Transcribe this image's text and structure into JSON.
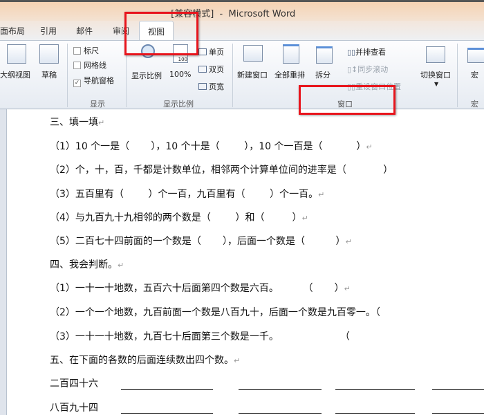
{
  "window": {
    "title": "一 [兼容模式]  -  Microsoft Word"
  },
  "tabs": [
    {
      "label": "面布局"
    },
    {
      "label": "引用"
    },
    {
      "label": "邮件"
    },
    {
      "label": "审阅"
    },
    {
      "label": "视图",
      "active": true
    }
  ],
  "ribbon": {
    "views": {
      "outline": "大纲视图",
      "draft": "草稿"
    },
    "show": {
      "label": "显示",
      "ruler": "标尺",
      "gridlines": "网格线",
      "nav_pane": "导航窗格",
      "ruler_checked": false,
      "gridlines_checked": false,
      "nav_pane_checked": true,
      "check_mark": "✓"
    },
    "zoom": {
      "label": "显示比例",
      "zoom": "显示比例",
      "hundred": "100%",
      "icon_100": "100",
      "one_page": "单页",
      "two_pages": "双页",
      "page_width": "页宽"
    },
    "window": {
      "label": "窗口",
      "new_window": "新建窗口",
      "arrange_all": "全部重排",
      "split": "拆分",
      "side_by_side": "并排查看",
      "sync_scroll": "同步滚动",
      "reset_position": "重设窗口位置",
      "switch_windows": "切换窗口"
    },
    "macros": {
      "label": "宏",
      "macros": "宏"
    }
  },
  "document": {
    "lines": [
      "三、填一填",
      "（1）10 个一是（       ），10 个十是（        ），10 个一百是（           ）",
      "（2）个，十，百，千都是计数单位，相邻两个计算单位间的进率是（            ）",
      "（3）五百里有（        ）个一百，九百里有（        ）个一百。",
      "（4）与九百九十九相邻的两个数是（        ）和（         ）",
      "（5）二百七十四前面的一个数是（       ），后面一个数是（          ）",
      "四、我会判断。",
      "（1）一十一十地数，五百六十后面第四个数是六百。        （       ）",
      "（2）一个一个地数，九百前面一个数是八百九十，后面一个数是九百零一。（",
      "（3）一十一十地数，九百七十后面第三个数是一千。                    （",
      "五、在下面的各数的后面连续数出四个数。",
      "二百四十六",
      "八百九十四"
    ],
    "return_mark": "↵"
  }
}
